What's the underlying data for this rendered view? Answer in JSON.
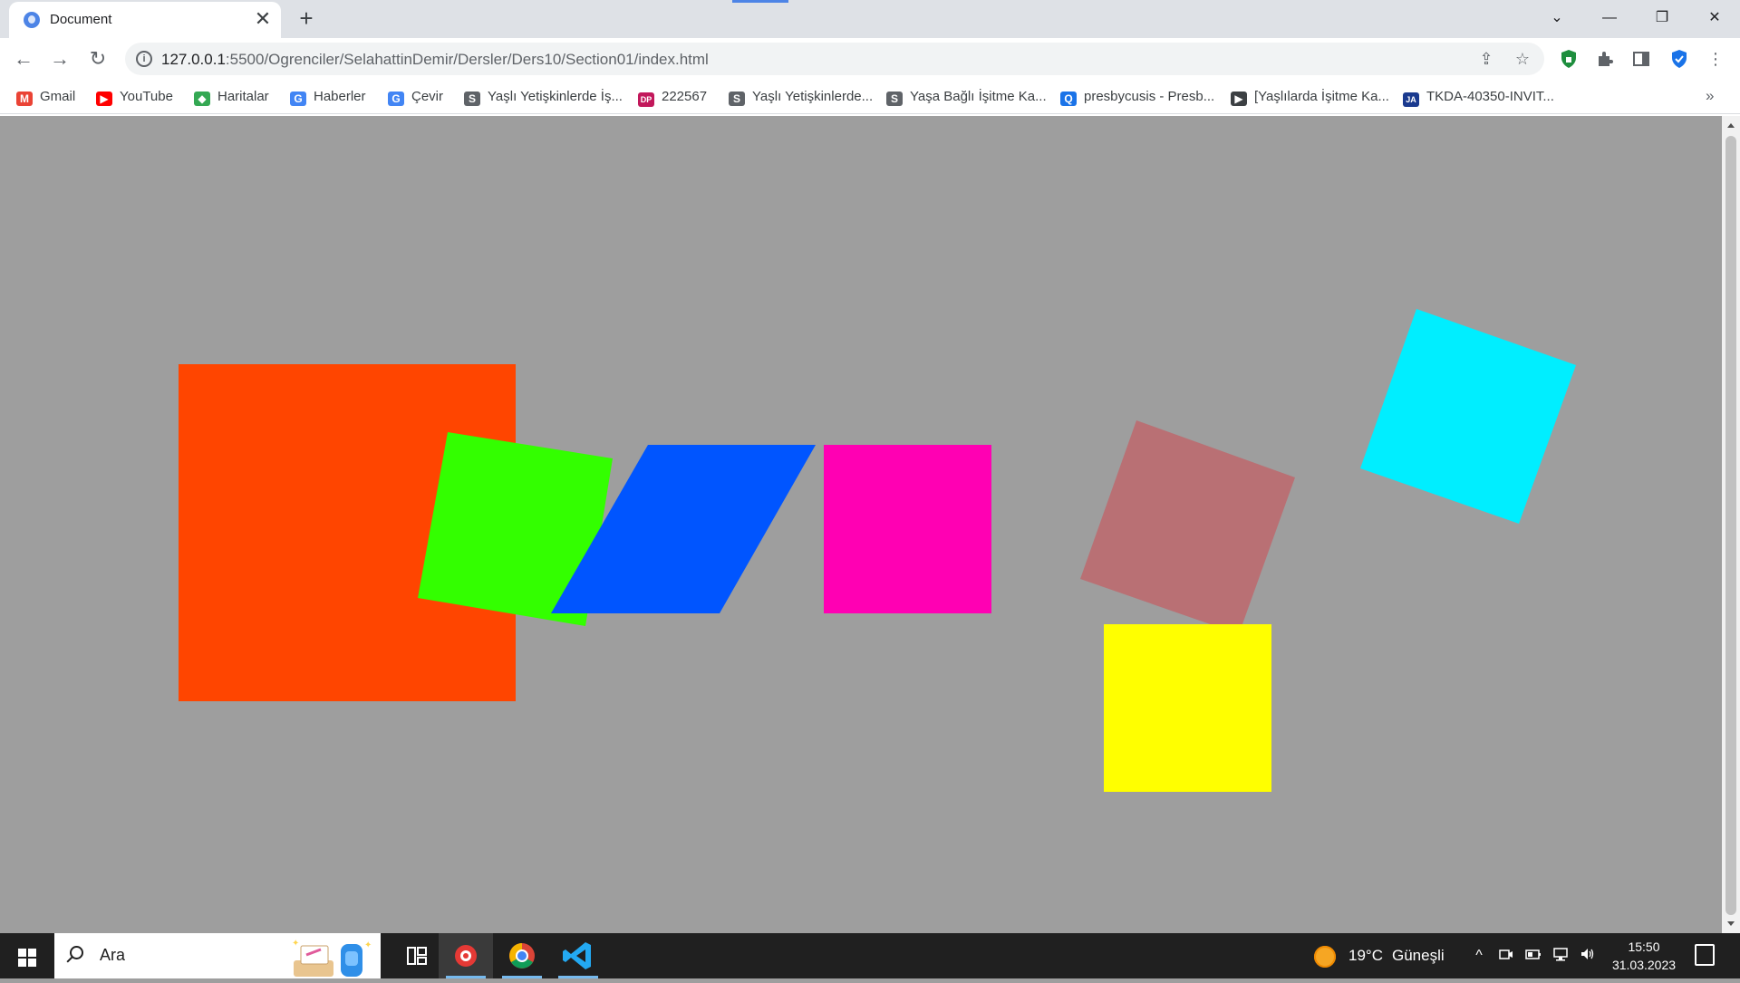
{
  "browser": {
    "tab": {
      "title": "Document",
      "close_glyph": "✕"
    },
    "new_tab_glyph": "+",
    "window_controls": {
      "list_tabs": "⌄",
      "minimize": "—",
      "restore": "❐",
      "close": "✕"
    },
    "nav": {
      "back": "←",
      "forward": "→",
      "reload": "↻"
    },
    "address": {
      "host": "127.0.0.1",
      "path": ":5500/Ogrenciler/SelahattinDemir/Dersler/Ders10/Section01/index.html"
    },
    "bookmarks": [
      {
        "label": "Gmail",
        "icon": "gmail-icon",
        "color": "#ea4335",
        "glyph": "M"
      },
      {
        "label": "YouTube",
        "icon": "youtube-icon",
        "color": "#ff0000",
        "glyph": "▶"
      },
      {
        "label": "Haritalar",
        "icon": "maps-icon",
        "color": "#34a853",
        "glyph": "◆"
      },
      {
        "label": "Haberler",
        "icon": "news-icon",
        "color": "#4285f4",
        "glyph": "G"
      },
      {
        "label": "Çevir",
        "icon": "translate-icon",
        "color": "#4285f4",
        "glyph": "G"
      },
      {
        "label": "Yaşlı Yetişkinlerde İş...",
        "icon": "link-icon",
        "color": "#5f6368",
        "glyph": "S"
      },
      {
        "label": "222567",
        "icon": "dp-icon",
        "color": "#c2185b",
        "glyph": "DP"
      },
      {
        "label": "Yaşlı Yetişkinlerde...",
        "icon": "link-icon",
        "color": "#5f6368",
        "glyph": "S"
      },
      {
        "label": "Yaşa Bağlı İşitme Ka...",
        "icon": "link-icon",
        "color": "#5f6368",
        "glyph": "S"
      },
      {
        "label": "presbycusis - Presb...",
        "icon": "search-result-icon",
        "color": "#1a73e8",
        "glyph": "Q"
      },
      {
        "label": "[Yaşlılarda İşitme Ka...",
        "icon": "document-icon",
        "color": "#3c4043",
        "glyph": "▶"
      },
      {
        "label": "TKDA-40350-INVIT...",
        "icon": "journal-icon",
        "color": "#1a3a8f",
        "glyph": "JA"
      }
    ],
    "bookmarks_more": "»"
  },
  "page": {
    "background": "#9e9e9e",
    "shapes": [
      {
        "name": "orange-square",
        "color": "#ff4500"
      },
      {
        "name": "green-square-rotated",
        "color": "#33ff00"
      },
      {
        "name": "blue-parallelogram",
        "color": "#0055ff"
      },
      {
        "name": "magenta-square",
        "color": "#ff00b3"
      },
      {
        "name": "rosybrown-square-rotated",
        "color": "#b97074"
      },
      {
        "name": "yellow-square",
        "color": "#ffff00"
      },
      {
        "name": "cyan-square-rotated",
        "color": "#00eeff"
      }
    ]
  },
  "taskbar": {
    "search_placeholder": "Ara",
    "weather": {
      "temp": "19°C",
      "condition": "Güneşli"
    },
    "clock": {
      "time": "15:50",
      "date": "31.03.2023"
    },
    "tray_expand": "^"
  }
}
